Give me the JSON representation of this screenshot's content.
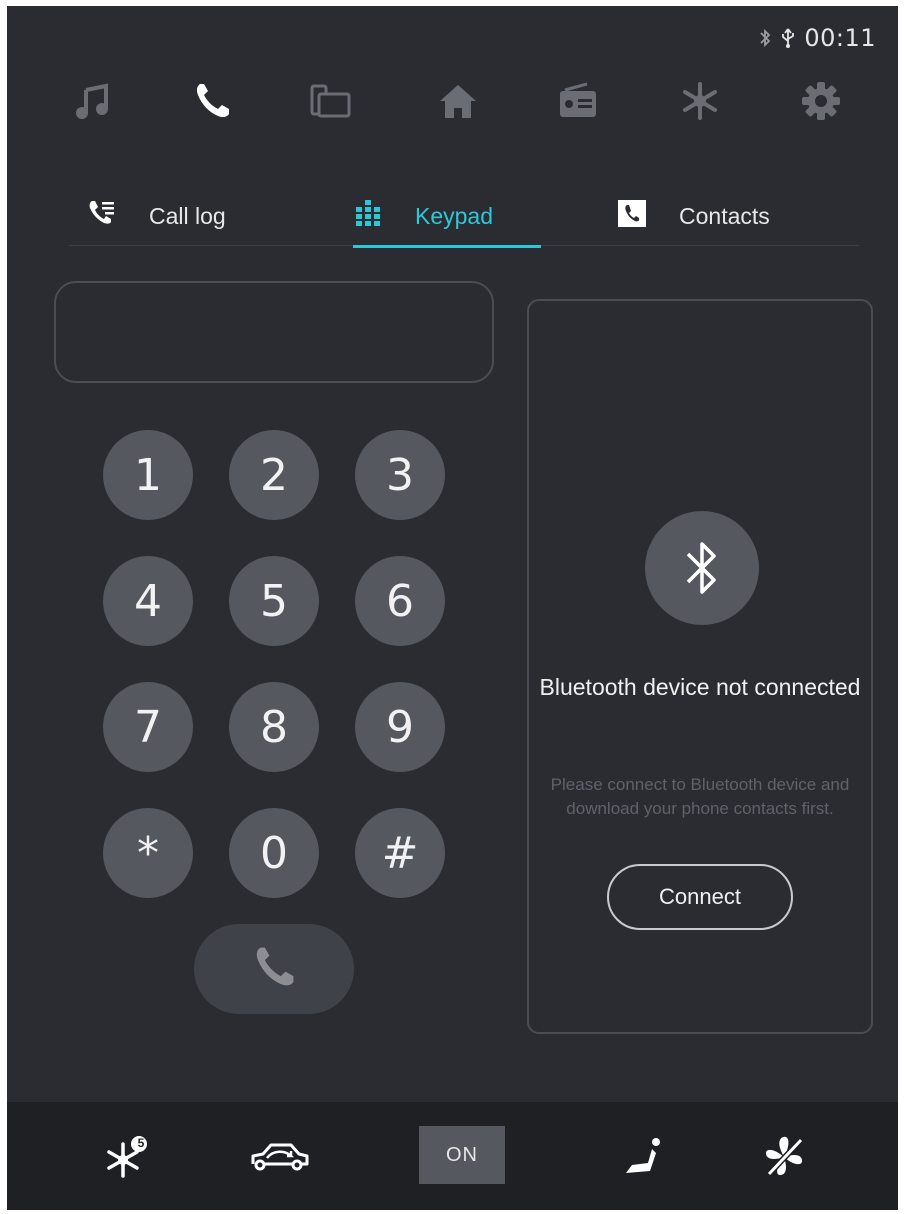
{
  "status_bar": {
    "time": "00:11",
    "icons": [
      "bluetooth-icon",
      "usb-icon"
    ]
  },
  "top_nav": {
    "items": [
      {
        "name": "music",
        "icon": "music-note-icon",
        "active": false
      },
      {
        "name": "phone",
        "icon": "phone-icon",
        "active": true
      },
      {
        "name": "screen-mirror",
        "icon": "screen-mirror-icon",
        "active": false
      },
      {
        "name": "home",
        "icon": "home-icon",
        "active": false
      },
      {
        "name": "radio",
        "icon": "radio-icon",
        "active": false
      },
      {
        "name": "climate",
        "icon": "snowflake-icon",
        "active": false
      },
      {
        "name": "settings",
        "icon": "gear-icon",
        "active": false
      }
    ]
  },
  "tabs": [
    {
      "label": "Call log",
      "icon": "call-log-icon",
      "active": false
    },
    {
      "label": "Keypad",
      "icon": "keypad-icon",
      "active": true
    },
    {
      "label": "Contacts",
      "icon": "contacts-icon",
      "active": false
    }
  ],
  "dialer": {
    "number": "",
    "keys": [
      "1",
      "2",
      "3",
      "4",
      "5",
      "6",
      "7",
      "8",
      "9",
      "*",
      "0",
      "#"
    ],
    "call_icon": "phone-icon"
  },
  "bluetooth_panel": {
    "icon": "bluetooth-icon",
    "title": "Bluetooth device not connected",
    "description": "Please connect to Bluetooth device and download your phone contacts first.",
    "connect_label": "Connect"
  },
  "bottom_bar": {
    "items": [
      {
        "name": "ac",
        "icon": "snowflake-icon",
        "badge": "5"
      },
      {
        "name": "recirculation",
        "icon": "car-recirculation-icon"
      },
      {
        "name": "power",
        "label": "ON"
      },
      {
        "name": "seat",
        "icon": "seat-icon"
      },
      {
        "name": "fan",
        "icon": "fan-off-icon"
      }
    ]
  },
  "colors": {
    "background": "#2a2c32",
    "accent": "#2ec7d6",
    "key": "#55585e",
    "bottom_bar": "#1e2024"
  }
}
